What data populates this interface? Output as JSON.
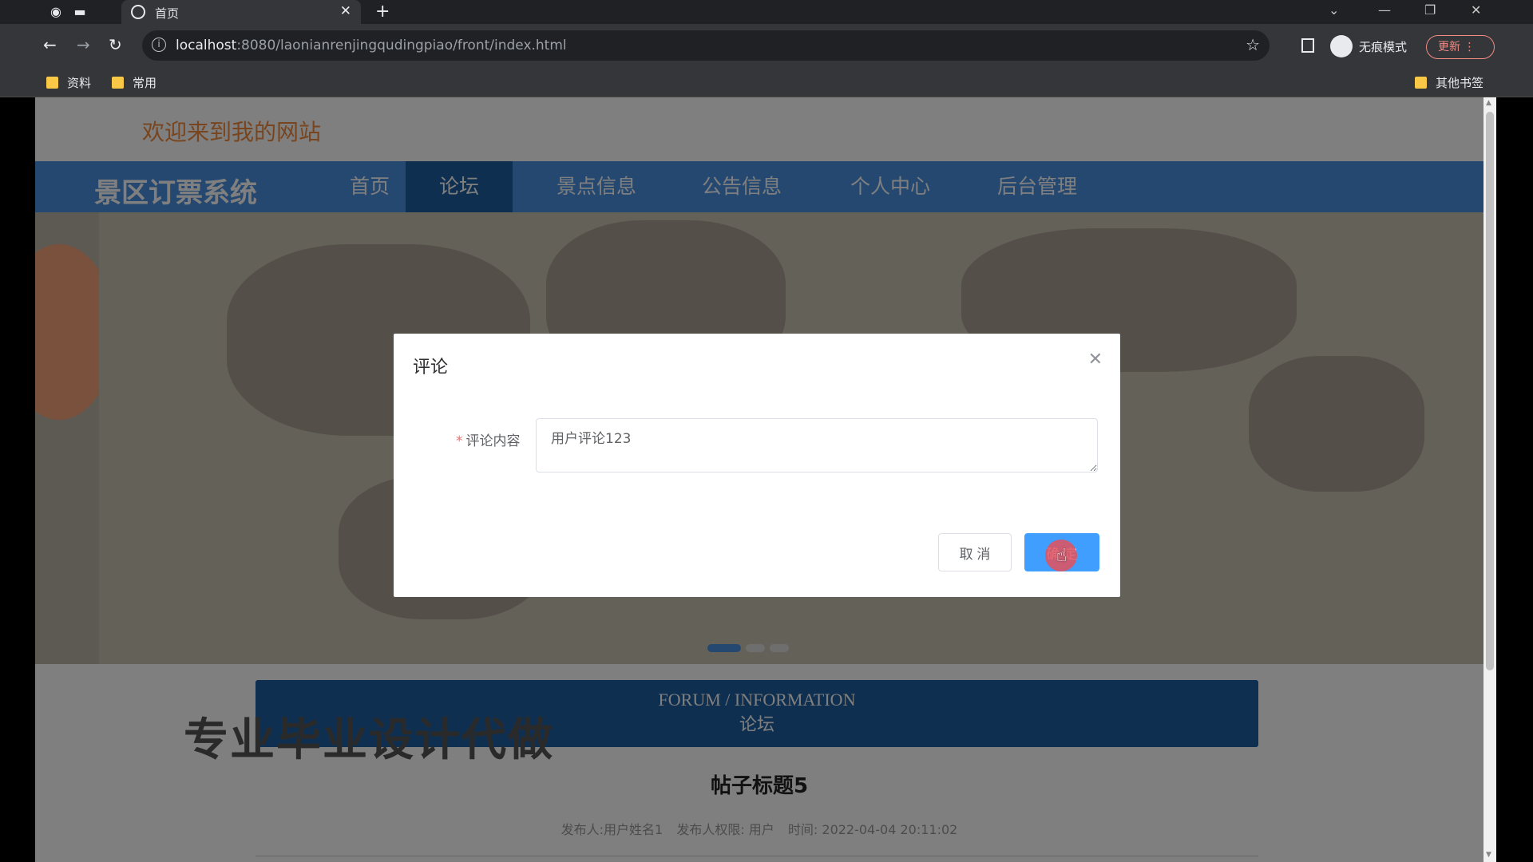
{
  "browser": {
    "tab_title": "首页",
    "url_host": "localhost",
    "url_path": ":8080/laonianrenjingqudingpiao/front/index.html",
    "incognito_label": "无痕模式",
    "update_label": "更新",
    "bookmarks": [
      "资料",
      "常用"
    ],
    "other_bookmarks": "其他书签"
  },
  "site": {
    "welcome": "欢迎来到我的网站",
    "brand": "景区订票系统",
    "nav": [
      {
        "label": "首页",
        "active": false
      },
      {
        "label": "论坛",
        "active": true
      },
      {
        "label": "景点信息",
        "active": false
      },
      {
        "label": "公告信息",
        "active": false
      },
      {
        "label": "个人中心",
        "active": false
      },
      {
        "label": "后台管理",
        "active": false
      }
    ],
    "section_en": "FORUM / INFORMATION",
    "section_cn": "论坛",
    "watermark": "专业毕业设计代做",
    "post": {
      "title": "帖子标题5",
      "meta_author": "发布人:用户姓名1",
      "meta_role": "发布人权限: 用户",
      "meta_time": "时间: 2022-04-04 20:11:02"
    }
  },
  "dialog": {
    "title": "评论",
    "field_label": "评论内容",
    "field_value": "用户评论123",
    "cancel_label": "取 消",
    "ok_label": "确 定"
  },
  "colors": {
    "nav_bg": "#4a90e2",
    "nav_active": "#1f5fa0",
    "welcome": "#f08a3c",
    "primary_button": "#409eff"
  }
}
